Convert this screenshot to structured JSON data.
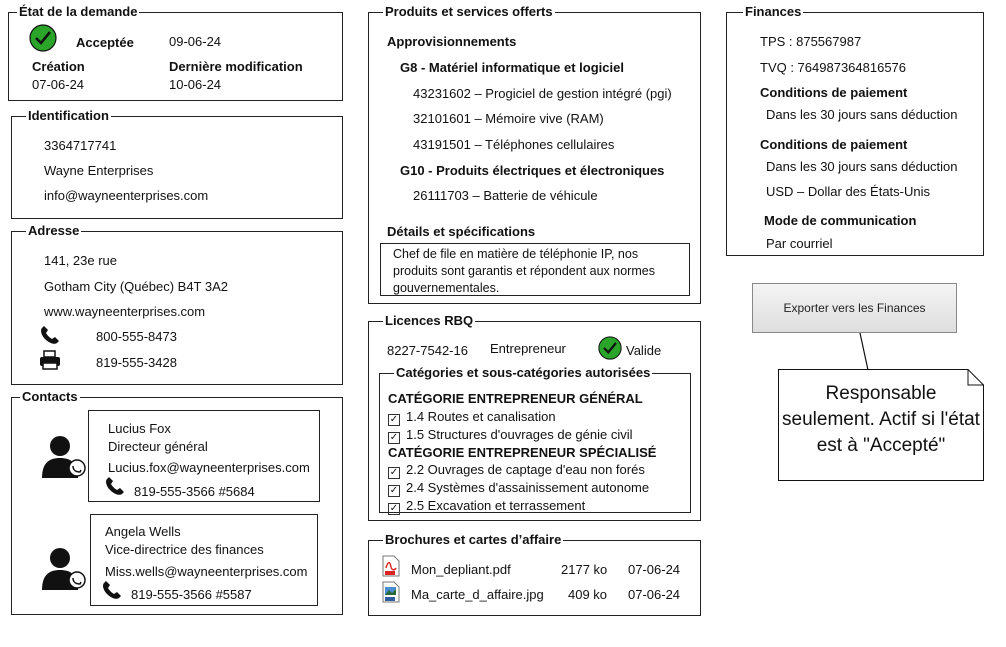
{
  "status": {
    "title": "État de la demande",
    "state": "Acceptée",
    "state_date": "09-06-24",
    "creation_label": "Création",
    "creation_date": "07-06-24",
    "modified_label": "Dernière modification",
    "modified_date": "10-06-24"
  },
  "identification": {
    "title": "Identification",
    "number": "3364717741",
    "name": "Wayne Enterprises",
    "email": "info@wayneenterprises.com"
  },
  "address": {
    "title": "Adresse",
    "street": "141, 23e rue",
    "city": "Gotham City (Québec)  B4T 3A2",
    "website": "www.wayneenterprises.com",
    "phone": "800-555-8473",
    "fax": "819-555-3428"
  },
  "contacts": {
    "title": "Contacts",
    "items": [
      {
        "name": "Lucius Fox",
        "role": "Directeur général",
        "email": "Lucius.fox@wayneenterprises.com",
        "phone": "819-555-3566 #5684"
      },
      {
        "name": "Angela Wells",
        "role": "Vice-directrice des finances",
        "email": "Miss.wells@wayneenterprises.com",
        "phone": "819-555-3566 #5587"
      }
    ]
  },
  "products": {
    "title": "Produits et services offerts",
    "section": "Approvisionnements",
    "groups": [
      {
        "label": "G8 - Matériel informatique et logiciel",
        "items": [
          "43231602 – Progiciel de gestion intégré (pgi)",
          "32101601 – Mémoire vive (RAM)",
          "43191501  – Téléphones cellulaires"
        ]
      },
      {
        "label": "G10 - Produits électriques et électroniques",
        "items": [
          "26111703 – Batterie de véhicule"
        ]
      }
    ],
    "details_label": "Détails et spécifications",
    "details_text": "Chef de file en matière de téléphonie IP, nos produits sont garantis et répondent aux normes gouvernementales."
  },
  "rbq": {
    "title": "Licences RBQ",
    "number": "8227-7542-16",
    "type": "Entrepreneur",
    "validity": "Valide",
    "categories_title": "Catégories et sous-catégories autorisées",
    "general_title": "CATÉGORIE ENTREPRENEUR GÉNÉRAL",
    "general_items": [
      "1.4 Routes et canalisation",
      "1.5 Structures d'ouvrages de génie civil"
    ],
    "special_title": "CATÉGORIE ENTREPRENEUR SPÉCIALISÉ",
    "special_items": [
      "2.2 Ouvrages de captage d'eau non forés",
      "2.4 Systèmes d'assainissement autonome",
      "2.5 Excavation et terrassement"
    ]
  },
  "brochures": {
    "title": "Brochures et cartes d’affaire",
    "files": [
      {
        "name": "Mon_depliant.pdf",
        "size": "2177 ko",
        "date": "07-06-24",
        "icon": "pdf-file-icon"
      },
      {
        "name": "Ma_carte_d_affaire.jpg",
        "size": "409 ko",
        "date": "07-06-24",
        "icon": "image-file-icon"
      }
    ]
  },
  "finances": {
    "title": "Finances",
    "tps": "TPS : 875567987",
    "tvq": "TVQ : 764987364816576",
    "terms1_label": "Conditions de paiement",
    "terms1_value": "Dans les 30 jours sans déduction",
    "terms2_label": "Conditions de paiement",
    "terms2_value": "Dans les 30 jours sans déduction",
    "currency": "USD – Dollar des États-Unis",
    "comm_label": "Mode de communication",
    "comm_value": "Par courriel"
  },
  "export_button": "Exporter vers les Finances",
  "annotation": "Responsable seulement.  Actif si l'état est à \"Accepté\"",
  "colors": {
    "check_green": "#2aa52a",
    "button_border": "#888888"
  }
}
